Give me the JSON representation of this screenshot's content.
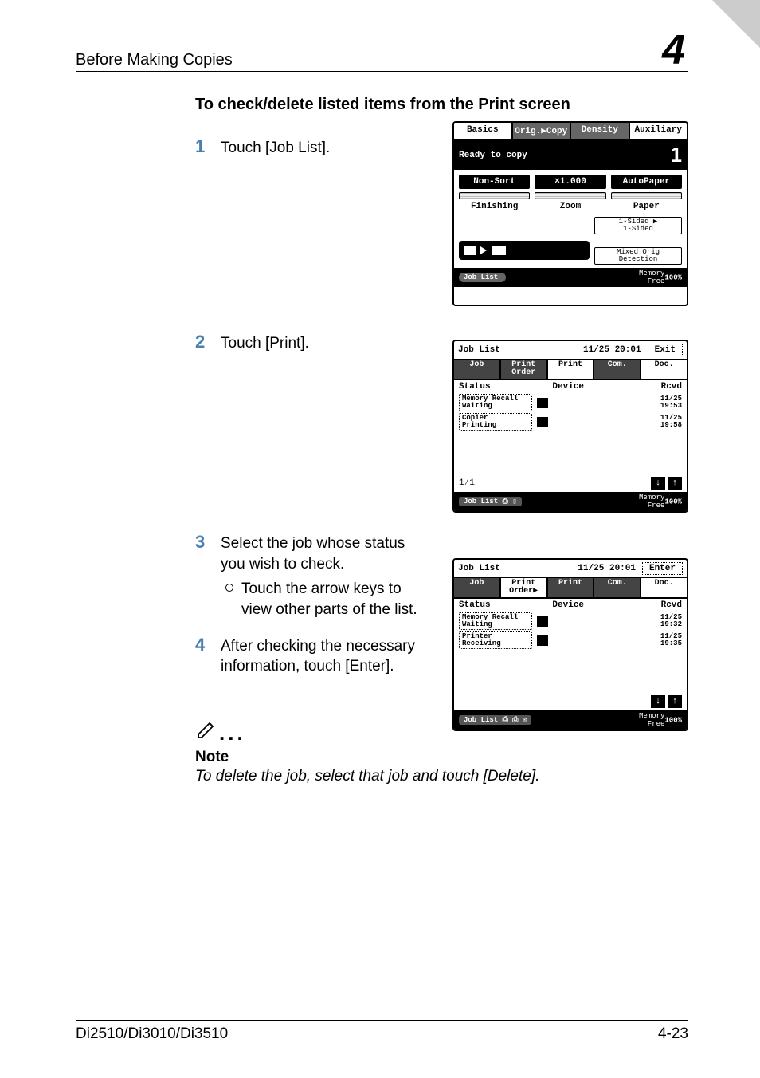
{
  "header": {
    "left": "Before Making Copies",
    "right": "4"
  },
  "section_title": "To check/delete listed items from the Print screen",
  "steps": {
    "s1": {
      "num": "1",
      "text": "Touch [Job List]."
    },
    "s2": {
      "num": "2",
      "text": "Touch [Print]."
    },
    "s3": {
      "num": "3",
      "text": "Select the job whose status you wish to check.",
      "sub": "Touch the arrow keys to view other parts of the list."
    },
    "s4": {
      "num": "4",
      "text": "After checking the necessary information, touch [Enter]."
    }
  },
  "note": {
    "dots": "...",
    "heading": "Note",
    "text": "To delete the job, select that job and touch [Delete]."
  },
  "footer": {
    "left": "Di2510/Di3010/Di3510",
    "right": "4-23"
  },
  "fig1": {
    "tabs": {
      "basics": "Basics",
      "orig": "Orig.▶Copy",
      "density": "Density",
      "aux": "Auxiliary"
    },
    "status": "Ready to copy",
    "count": "1",
    "row_btns": {
      "nonsort": "Non-Sort",
      "x1000": "×1.000",
      "autopaper": "AutoPaper"
    },
    "row_labels": {
      "finishing": "Finishing",
      "zoom": "Zoom",
      "paper": "Paper"
    },
    "right_small": {
      "sided": "1-Sided ▶\n1-Sided",
      "mixed": "Mixed Orig\nDetection"
    },
    "joblist_btn": "Job List",
    "mem": "Memory\nFree",
    "mem_pct": "100%"
  },
  "fig2": {
    "title": "Job List",
    "datetime": "11/25 20:01",
    "exit": "Exit",
    "tabs": {
      "job": "Job",
      "printorder": "Print\nOrder",
      "print": "Print",
      "com": "Com.",
      "doc": "Doc."
    },
    "cols": {
      "status": "Status",
      "device": "Device",
      "rcvd": "Rcvd"
    },
    "r1": {
      "name": "Memory Recall\nWaiting",
      "time": "11/25\n19:53"
    },
    "r2": {
      "name": "Copier\nPrinting",
      "time": "11/25\n19:58"
    },
    "pager": "1⁄1",
    "job_tag": "Job List",
    "mem": "Memory\nFree",
    "mem_pct": "100%"
  },
  "fig3": {
    "title": "Job List",
    "datetime": "11/25 20:01",
    "enter": "Enter",
    "tabs": {
      "job": "Job",
      "printorder": "Print\nOrder▶",
      "print": "Print",
      "com": "Com.",
      "doc": "Doc."
    },
    "cols": {
      "status": "Status",
      "device": "Device",
      "rcvd": "Rcvd"
    },
    "r1": {
      "name": "Memory Recall\nWaiting",
      "time": "11/25\n19:32"
    },
    "r2": {
      "name": "Printer\nReceiving",
      "time": "11/25\n19:35"
    },
    "job_tag": "Job List",
    "mem": "Memory\nFree",
    "mem_pct": "100%"
  }
}
